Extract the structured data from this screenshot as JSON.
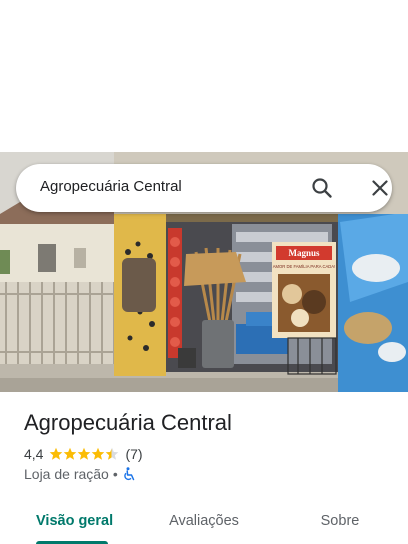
{
  "search": {
    "query": "Agropecuária Central",
    "search_icon": "search-icon",
    "close_icon": "close-icon"
  },
  "photo": {
    "sign_title": "Magnus",
    "sign_subtitle": "AMOR DE FAMÍLIA PARA CADA!"
  },
  "place": {
    "name": "Agropecuária Central",
    "rating": "4,4",
    "rating_value": 4.4,
    "review_count": "(7)",
    "category": "Loja de ração",
    "separator": "•",
    "accessibility_icon": "wheelchair-icon"
  },
  "tabs": [
    {
      "label": "Visão geral",
      "active": true
    },
    {
      "label": "Avaliações",
      "active": false
    },
    {
      "label": "Sobre",
      "active": false
    }
  ],
  "colors": {
    "accent": "#00796b",
    "star": "#fbbc04",
    "accessibility": "#1a73e8"
  }
}
